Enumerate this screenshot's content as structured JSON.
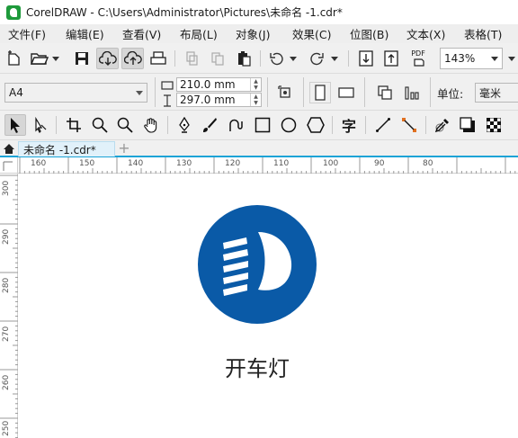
{
  "titlebar": {
    "title": "CorelDRAW - C:\\Users\\Administrator\\Pictures\\未命名 -1.cdr*",
    "logo_icon": "coreldraw-logo-icon"
  },
  "menubar": {
    "items": [
      {
        "label": "文件(F)"
      },
      {
        "label": "编辑(E)"
      },
      {
        "label": "查看(V)"
      },
      {
        "label": "布局(L)"
      },
      {
        "label": "对象(J)"
      },
      {
        "label": "效果(C)"
      },
      {
        "label": "位图(B)"
      },
      {
        "label": "文本(X)"
      },
      {
        "label": "表格(T)"
      }
    ]
  },
  "standard_toolbar": {
    "icons": [
      "new-document-icon",
      "open-folder-icon",
      "save-icon",
      "cloud-download-icon",
      "cloud-upload-icon",
      "print-icon",
      "cut-icon",
      "copy-icon",
      "paste-icon",
      "undo-icon",
      "redo-icon",
      "import-icon",
      "export-icon",
      "pdf-icon"
    ],
    "pdf_label": "PDF",
    "zoom_level": "143%"
  },
  "property_bar": {
    "page_size": "A4",
    "width": "210.0 mm",
    "height": "297.0 mm",
    "units_label": "单位:",
    "units_value": "毫米"
  },
  "toolbox": {
    "icons": [
      "pick-tool-icon",
      "shape-tool-icon",
      "crop-tool-icon",
      "zoom-tool-icon",
      "zoom-out-tool-icon",
      "pan-tool-icon",
      "pen-tool-icon",
      "artistic-media-icon",
      "spiral-tool-icon",
      "rectangle-tool-icon",
      "ellipse-tool-icon",
      "polygon-tool-icon",
      "text-tool-icon",
      "line-tool-icon",
      "connector-tool-icon",
      "eyedropper-icon",
      "shadow-tool-icon",
      "transparency-tool-icon"
    ],
    "text_tool_glyph": "字"
  },
  "tabs": {
    "document_tab": "未命名 -1.cdr*",
    "add_tab": "+"
  },
  "rulers": {
    "horizontal_labels": [
      "160",
      "150",
      "140",
      "130",
      "120",
      "110",
      "100",
      "90",
      "80"
    ],
    "vertical_labels": [
      "300",
      "290",
      "280",
      "270",
      "260",
      "250"
    ],
    "units": "毫米"
  },
  "canvas": {
    "icon": "headlight-icon",
    "icon_color": "#0a5aa7",
    "caption": "开车灯"
  },
  "colors": {
    "accent": "#1aa3d6",
    "brand_green": "#1e9a3b",
    "icon_blue": "#0a5aa7"
  }
}
